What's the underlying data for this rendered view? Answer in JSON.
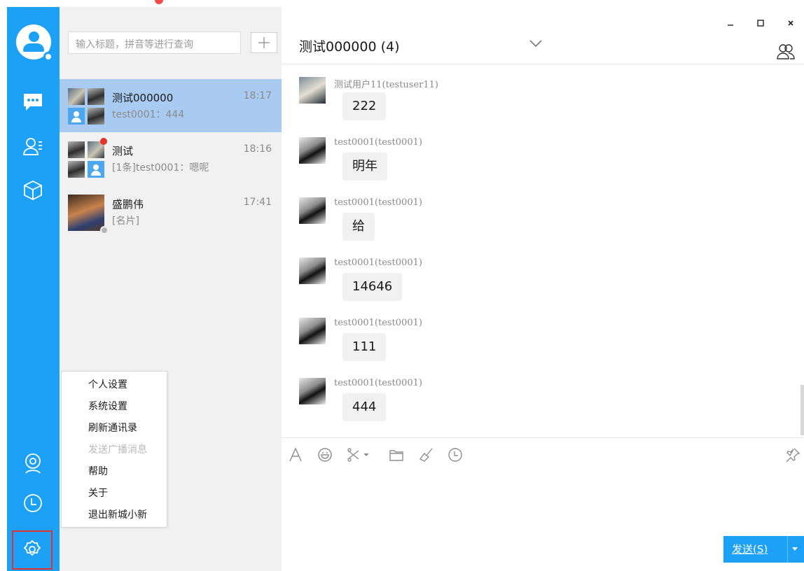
{
  "search": {
    "placeholder": "输入标题，拼音等进行查询"
  },
  "conversations": [
    {
      "name": "测试000000",
      "preview": "test0001：444",
      "time": "18:17",
      "active": true
    },
    {
      "name": "测试",
      "preview": "[1条]test0001：嗯呢",
      "time": "18:16",
      "unread": true
    },
    {
      "name": "盛鹏伟",
      "preview": "[名片]",
      "time": "17:41",
      "offline": true
    }
  ],
  "menu": {
    "items": [
      {
        "label": "个人设置",
        "enabled": true
      },
      {
        "label": "系统设置",
        "enabled": true
      },
      {
        "label": "刷新通讯录",
        "enabled": true
      },
      {
        "label": "发送广播消息",
        "enabled": false
      },
      {
        "label": "帮助",
        "enabled": true
      },
      {
        "label": "关于",
        "enabled": true
      },
      {
        "label": "退出新城小新",
        "enabled": true
      }
    ]
  },
  "chat": {
    "title": "测试000000 (4)",
    "messages": [
      {
        "sender": "测试用户11(testuser11)",
        "text": "222"
      },
      {
        "sender": "test0001(test0001)",
        "text": "明年"
      },
      {
        "sender": "test0001(test0001)",
        "text": "给"
      },
      {
        "sender": "test0001(test0001)",
        "text": "14646"
      },
      {
        "sender": "test0001(test0001)",
        "text": "111"
      },
      {
        "sender": "test0001(test0001)",
        "text": "444"
      }
    ]
  },
  "input": {
    "send_label": "发送(S)"
  },
  "window": {
    "minimize": "–",
    "maximize": "☐",
    "close": "×"
  },
  "colors": {
    "accent": "#1da1f6",
    "active_row": "#a9cbf1",
    "highlight_border": "#e0322e"
  }
}
